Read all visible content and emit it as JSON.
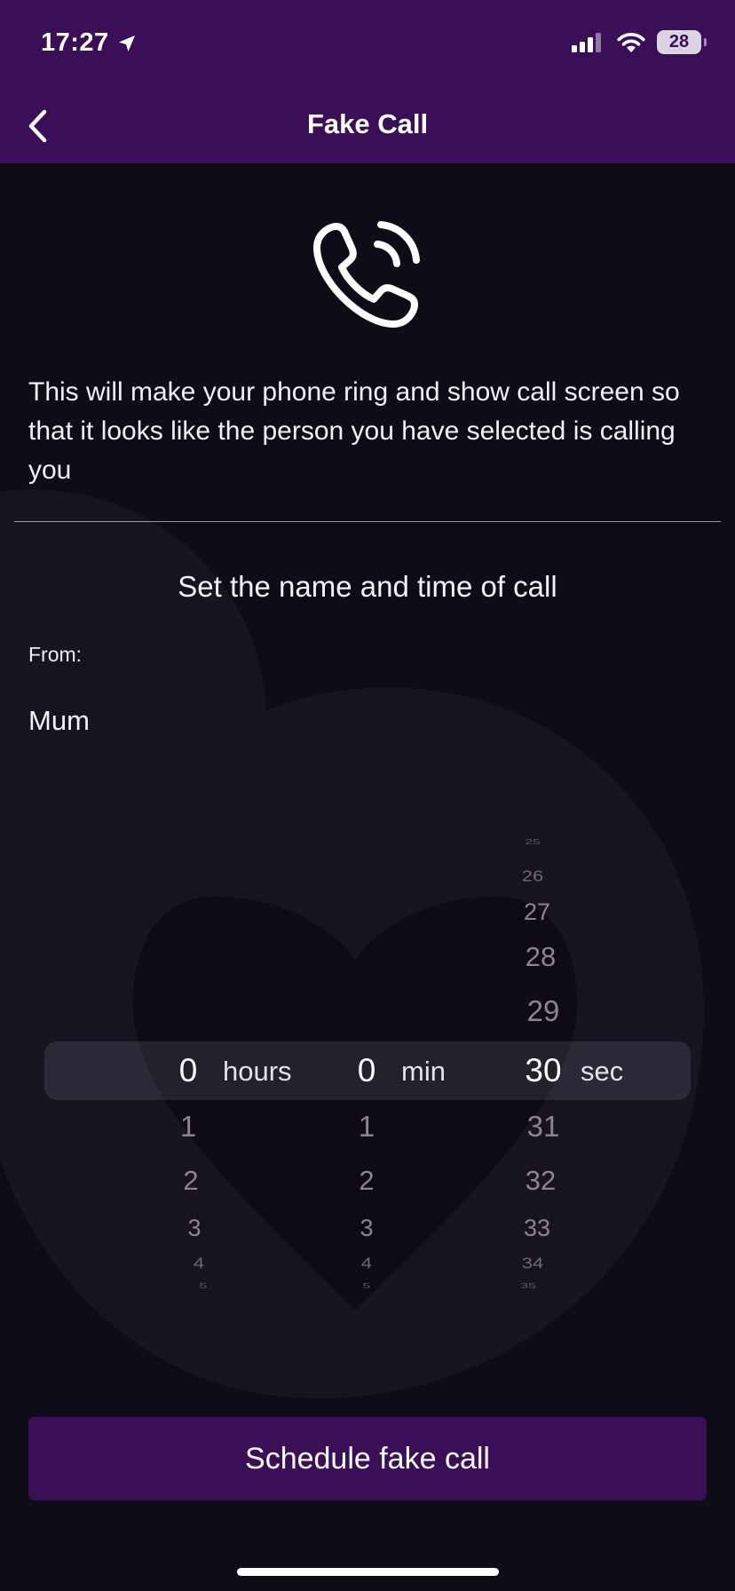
{
  "status_bar": {
    "time": "17:27",
    "battery": "28",
    "icons": [
      "location-arrow-icon",
      "signal-icon",
      "wifi-icon",
      "battery-icon"
    ]
  },
  "nav": {
    "title": "Fake Call",
    "back_icon": "chevron-left-icon"
  },
  "content": {
    "icon": "phone-ringing-icon",
    "description": "This will make your phone ring and show call screen so that it looks like the person you have selected is calling you",
    "section_title": "Set the name and time of call",
    "from_label": "From:",
    "from_value": "Mum"
  },
  "picker": {
    "hours": {
      "selected": "0",
      "unit": "hours",
      "after": [
        "1",
        "2",
        "3",
        "4",
        "5"
      ]
    },
    "minutes": {
      "selected": "0",
      "unit": "min",
      "after": [
        "1",
        "2",
        "3",
        "4",
        "5"
      ]
    },
    "seconds": {
      "before": [
        "25",
        "26",
        "27",
        "28",
        "29"
      ],
      "selected": "30",
      "unit": "sec",
      "after": [
        "31",
        "32",
        "33",
        "34",
        "35"
      ]
    }
  },
  "actions": {
    "schedule_label": "Schedule fake call"
  },
  "colors": {
    "header": "#3a0f58",
    "background": "#100c17",
    "button": "#3a0f58",
    "text": "#ffffff",
    "picker_dim": "#8a8590"
  }
}
